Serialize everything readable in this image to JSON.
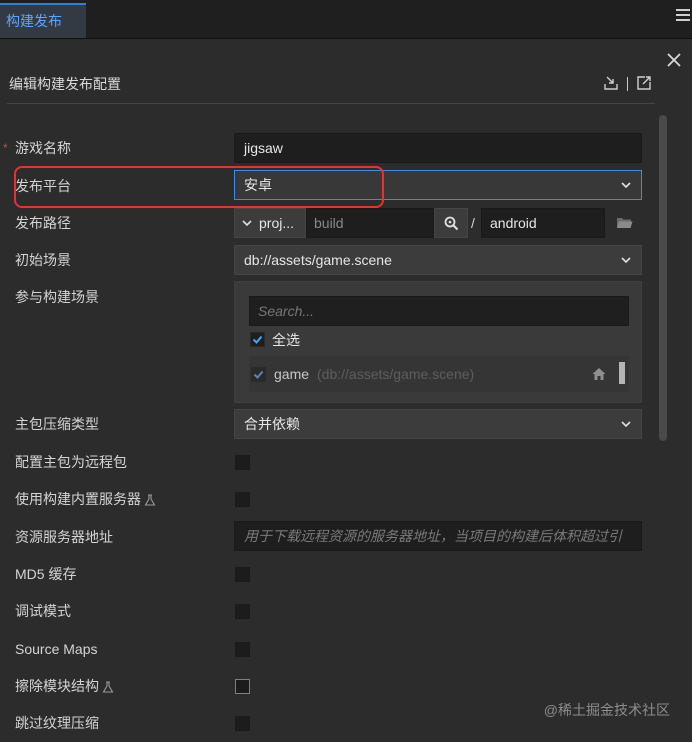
{
  "tab": {
    "label": "构建发布"
  },
  "panel": {
    "title": "编辑构建发布配置"
  },
  "fields": {
    "game_name": {
      "label": "游戏名称",
      "required_mark": "*",
      "value": "jigsaw"
    },
    "platform": {
      "label": "发布平台",
      "value": "安卓"
    },
    "build_path": {
      "label": "发布路径",
      "prefix": "proj...",
      "dir": "build",
      "slash": "/",
      "subdir": "android"
    },
    "start_scene": {
      "label": "初始场景",
      "value": "db://assets/game.scene"
    },
    "build_scenes": {
      "label": "参与构建场景",
      "search_placeholder": "Search...",
      "select_all": "全选",
      "items": [
        {
          "name": "game",
          "path": "(db://assets/game.scene)"
        }
      ]
    },
    "compress_type": {
      "label": "主包压缩类型",
      "value": "合并依赖"
    },
    "remote_main": {
      "label": "配置主包为远程包"
    },
    "builtin_server": {
      "label": "使用构建内置服务器"
    },
    "server_address": {
      "label": "资源服务器地址",
      "placeholder": "用于下载远程资源的服务器地址，当项目的构建后体积超过引"
    },
    "md5": {
      "label": "MD5 缓存"
    },
    "debug": {
      "label": "调试模式"
    },
    "source_maps": {
      "label": "Source Maps"
    },
    "erase_module": {
      "label": "擦除模块结构"
    },
    "skip_texture": {
      "label": "跳过纹理压缩"
    }
  },
  "watermark": "@稀土掘金技术社区",
  "colors": {
    "accent": "#3a8ee6",
    "highlight": "#e8322f",
    "tab_text": "#5aa6ff"
  },
  "icons": [
    "menu-icon",
    "close-icon",
    "import-icon",
    "export-icon",
    "chevron-down-icon",
    "search-icon",
    "folder-icon",
    "home-icon",
    "flask-icon",
    "check-icon"
  ]
}
